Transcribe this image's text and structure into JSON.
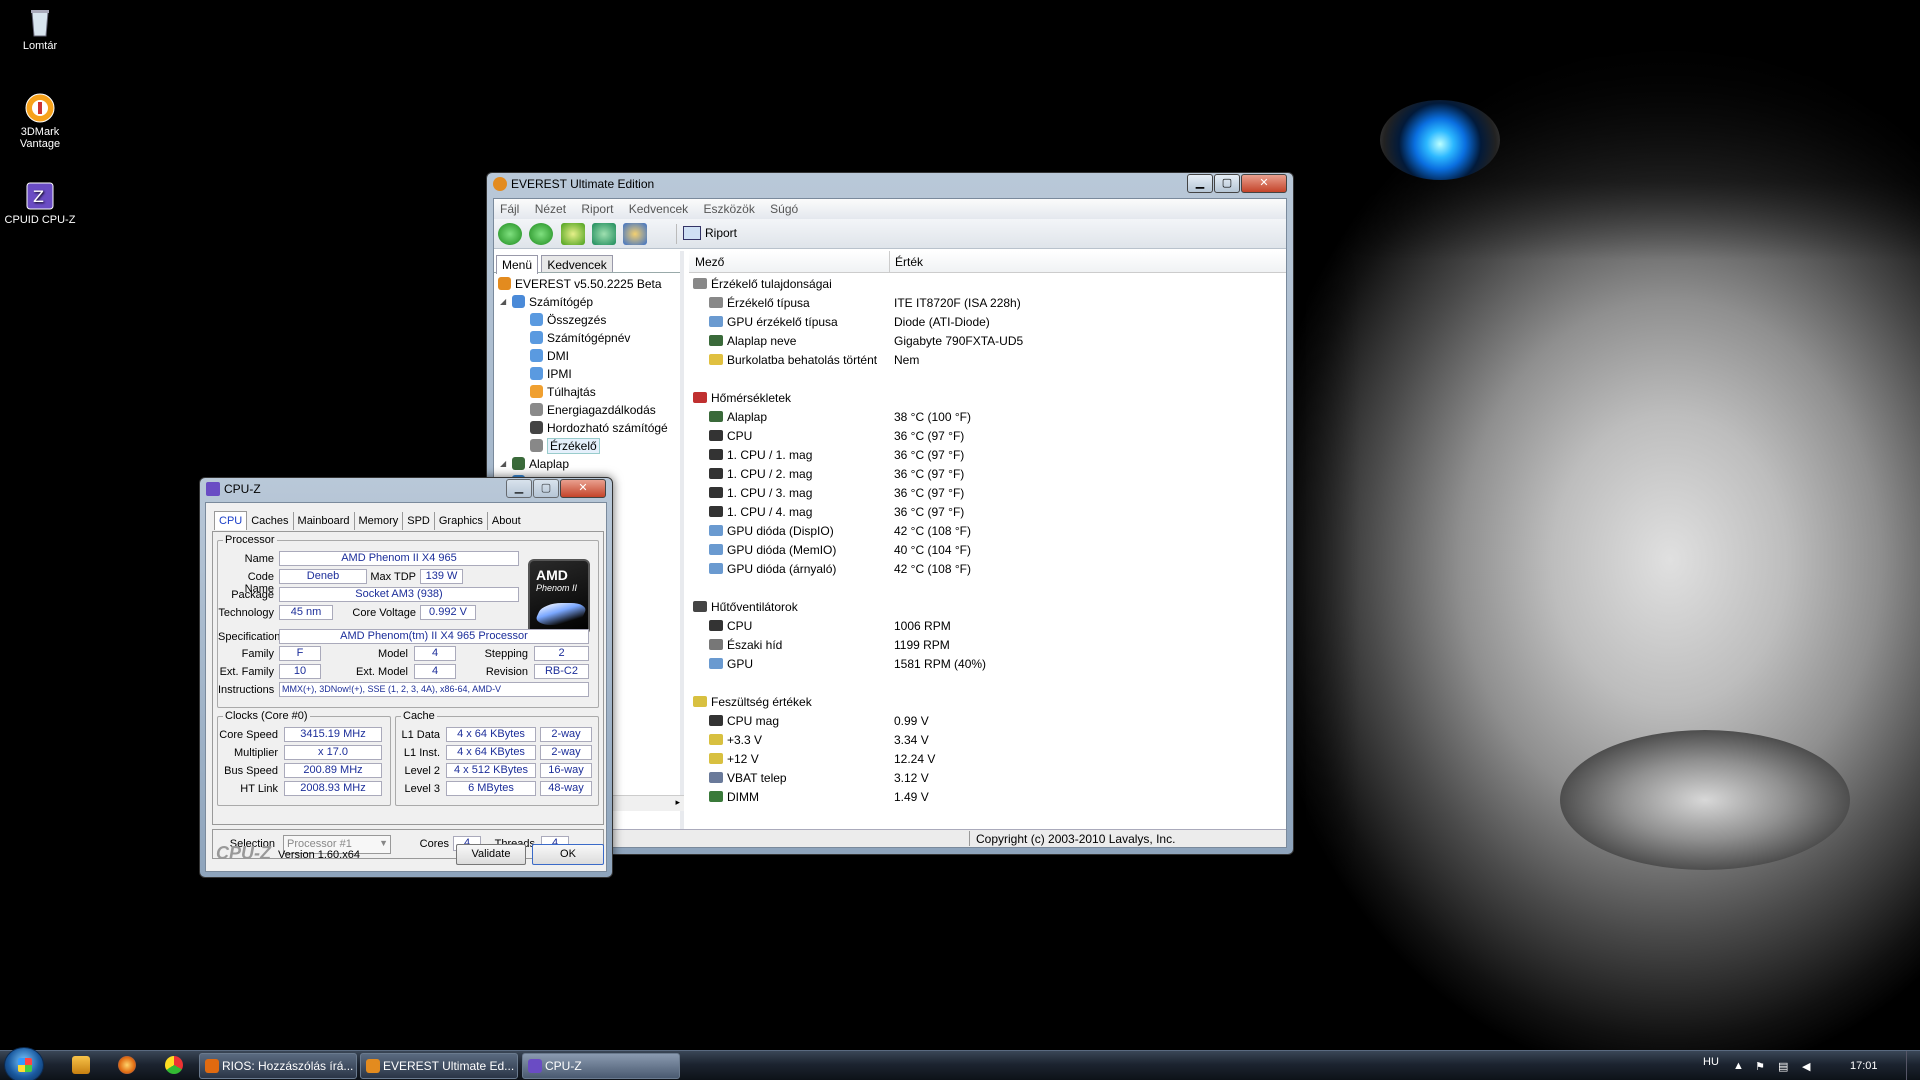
{
  "desktop": {
    "icons": [
      {
        "label": "Lomtár",
        "icon": "recycle-bin-icon"
      },
      {
        "label": "3DMark Vantage",
        "icon": "3dmark-icon"
      },
      {
        "label": "CPUID CPU-Z",
        "icon": "cpuz-icon"
      }
    ]
  },
  "everest": {
    "title": "EVEREST Ultimate Edition",
    "menu": [
      "Fájl",
      "Nézet",
      "Riport",
      "Kedvencek",
      "Eszközök",
      "Súgó"
    ],
    "toolbar": {
      "report_label": "Riport"
    },
    "left_tabs": [
      "Menü",
      "Kedvencek"
    ],
    "tree": [
      {
        "label": "EVEREST v5.50.2225 Beta",
        "level": 0,
        "icon": "info-icon"
      },
      {
        "label": "Számítógép",
        "level": 1,
        "icon": "computer-icon"
      },
      {
        "label": "Összegzés",
        "level": 2,
        "icon": "summary-icon"
      },
      {
        "label": "Számítógépnév",
        "level": 2,
        "icon": "computer-name-icon"
      },
      {
        "label": "DMI",
        "level": 2,
        "icon": "dmi-icon"
      },
      {
        "label": "IPMI",
        "level": 2,
        "icon": "ipmi-icon"
      },
      {
        "label": "Túlhajtás",
        "level": 2,
        "icon": "overclock-icon"
      },
      {
        "label": "Energiagazdálkodás",
        "level": 2,
        "icon": "power-icon"
      },
      {
        "label": "Hordozható számítógé",
        "level": 2,
        "icon": "portable-icon"
      },
      {
        "label": "Érzékelő",
        "level": 2,
        "icon": "sensor-icon",
        "selected": true
      },
      {
        "label": "Alaplap",
        "level": 1,
        "icon": "motherboard-icon"
      },
      {
        "label": "dszer",
        "level": 1,
        "icon": "os-icon"
      }
    ],
    "columns": {
      "field": "Mező",
      "value": "Érték"
    },
    "sections": [
      {
        "title": "Érzékelő tulajdonságai",
        "icon": "sensor-icon",
        "rows": [
          {
            "field": "Érzékelő típusa",
            "value": "ITE IT8720F  (ISA 228h)",
            "icon": "sensor-icon"
          },
          {
            "field": "GPU érzékelő típusa",
            "value": "Diode  (ATI-Diode)",
            "icon": "gpu-icon"
          },
          {
            "field": "Alaplap neve",
            "value": "Gigabyte 790FXTA-UD5",
            "icon": "motherboard-icon"
          },
          {
            "field": "Burkolatba behatolás történt",
            "value": "Nem",
            "icon": "lock-icon"
          }
        ]
      },
      {
        "title": "Hőmérsékletek",
        "icon": "thermometer-icon",
        "rows": [
          {
            "field": "Alaplap",
            "value": "38 °C  (100 °F)",
            "icon": "motherboard-icon"
          },
          {
            "field": "CPU",
            "value": "36 °C  (97 °F)",
            "icon": "cpu-icon"
          },
          {
            "field": "1. CPU / 1. mag",
            "value": "36 °C  (97 °F)",
            "icon": "cpu-icon"
          },
          {
            "field": "1. CPU / 2. mag",
            "value": "36 °C  (97 °F)",
            "icon": "cpu-icon"
          },
          {
            "field": "1. CPU / 3. mag",
            "value": "36 °C  (97 °F)",
            "icon": "cpu-icon"
          },
          {
            "field": "1. CPU / 4. mag",
            "value": "36 °C  (97 °F)",
            "icon": "cpu-icon"
          },
          {
            "field": "GPU dióda (DispIO)",
            "value": "42 °C  (108 °F)",
            "icon": "gpu-icon"
          },
          {
            "field": "GPU dióda (MemIO)",
            "value": "40 °C  (104 °F)",
            "icon": "gpu-icon"
          },
          {
            "field": "GPU dióda (árnyaló)",
            "value": "42 °C  (108 °F)",
            "icon": "gpu-icon"
          }
        ]
      },
      {
        "title": "Hűtőventilátorok",
        "icon": "fan-icon",
        "rows": [
          {
            "field": "CPU",
            "value": "1006 RPM",
            "icon": "cpu-icon"
          },
          {
            "field": "Északi híd",
            "value": "1199 RPM",
            "icon": "chipset-icon"
          },
          {
            "field": "GPU",
            "value": "1581 RPM  (40%)",
            "icon": "gpu-icon"
          }
        ]
      },
      {
        "title": "Feszültség értékek",
        "icon": "voltage-icon",
        "rows": [
          {
            "field": "CPU mag",
            "value": "0.99 V",
            "icon": "cpu-icon"
          },
          {
            "field": "+3.3 V",
            "value": "3.34 V",
            "icon": "voltage-icon"
          },
          {
            "field": "+12 V",
            "value": "12.24 V",
            "icon": "voltage-icon"
          },
          {
            "field": "VBAT telep",
            "value": "3.12 V",
            "icon": "battery-icon"
          },
          {
            "field": "DIMM",
            "value": "1.49 V",
            "icon": "memory-icon"
          }
        ]
      }
    ],
    "status": "Copyright (c) 2003-2010 Lavalys, Inc."
  },
  "cpuz": {
    "title": "CPU-Z",
    "tabs": [
      "CPU",
      "Caches",
      "Mainboard",
      "Memory",
      "SPD",
      "Graphics",
      "About"
    ],
    "processor": {
      "group": "Processor",
      "name_label": "Name",
      "name": "AMD Phenom II X4 965",
      "codename_label": "Code Name",
      "codename": "Deneb",
      "maxtdp_label": "Max TDP",
      "maxtdp": "139 W",
      "package_label": "Package",
      "package": "Socket AM3 (938)",
      "technology_label": "Technology",
      "technology": "45 nm",
      "corevoltage_label": "Core Voltage",
      "corevoltage": "0.992 V",
      "spec_label": "Specification",
      "spec": "AMD Phenom(tm) II X4 965 Processor",
      "family_label": "Family",
      "family": "F",
      "model_label": "Model",
      "model": "4",
      "stepping_label": "Stepping",
      "stepping": "2",
      "extfamily_label": "Ext. Family",
      "extfamily": "10",
      "extmodel_label": "Ext. Model",
      "extmodel": "4",
      "revision_label": "Revision",
      "revision": "RB-C2",
      "instructions_label": "Instructions",
      "instructions": "MMX(+), 3DNow!(+), SSE (1, 2, 3, 4A), x86-64, AMD-V",
      "logo_brand": "AMD",
      "logo_line": "Phenom II"
    },
    "clocks": {
      "group": "Clocks (Core #0)",
      "corespeed_label": "Core Speed",
      "corespeed": "3415.19 MHz",
      "multiplier_label": "Multiplier",
      "multiplier": "x 17.0",
      "busspeed_label": "Bus Speed",
      "busspeed": "200.89 MHz",
      "htlink_label": "HT Link",
      "htlink": "2008.93 MHz"
    },
    "cache": {
      "group": "Cache",
      "rows": [
        {
          "label": "L1 Data",
          "size": "4 x 64 KBytes",
          "way": "2-way"
        },
        {
          "label": "L1 Inst.",
          "size": "4 x 64 KBytes",
          "way": "2-way"
        },
        {
          "label": "Level 2",
          "size": "4 x 512 KBytes",
          "way": "16-way"
        },
        {
          "label": "Level 3",
          "size": "6 MBytes",
          "way": "48-way"
        }
      ]
    },
    "selection": {
      "label": "Selection",
      "value": "Processor #1",
      "cores_label": "Cores",
      "cores": "4",
      "threads_label": "Threads",
      "threads": "4"
    },
    "footer": {
      "logo": "CPU-Z",
      "version": "Version 1.60.x64",
      "validate": "Validate",
      "ok": "OK"
    }
  },
  "taskbar": {
    "tasks": [
      {
        "label": "RIOS: Hozzászólás írá...",
        "icon": "firefox-icon"
      },
      {
        "label": "EVEREST Ultimate Ed...",
        "icon": "everest-icon"
      },
      {
        "label": "CPU-Z",
        "icon": "cpuz-icon",
        "active": true
      }
    ],
    "lang": "HU",
    "clock": "17:01"
  }
}
